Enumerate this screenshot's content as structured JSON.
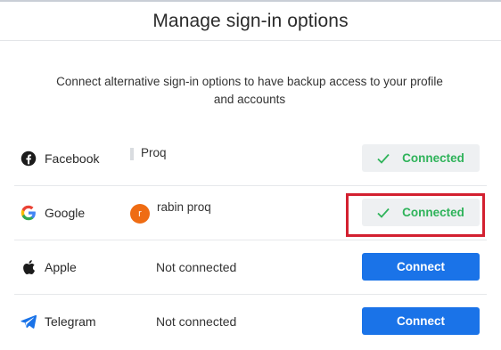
{
  "dialog": {
    "title": "Manage sign-in options",
    "description": "Connect alternative sign-in options to have backup access to your profile and accounts"
  },
  "providers": [
    {
      "name": "Facebook",
      "icon": "facebook-icon",
      "account": "Proq",
      "status_label": "Connected",
      "connected": true
    },
    {
      "name": "Google",
      "icon": "google-icon",
      "account": "rabin proq",
      "avatar_letter": "r",
      "status_label": "Connected",
      "connected": true
    },
    {
      "name": "Apple",
      "icon": "apple-icon",
      "status_text": "Not connected",
      "button_label": "Connect",
      "connected": false
    },
    {
      "name": "Telegram",
      "icon": "telegram-icon",
      "status_text": "Not connected",
      "button_label": "Connect",
      "connected": false
    }
  ],
  "colors": {
    "accent": "#1a73e8",
    "connected_green": "#2fb35a",
    "highlight_red": "#d32030",
    "avatar_orange": "#ef6c13"
  }
}
